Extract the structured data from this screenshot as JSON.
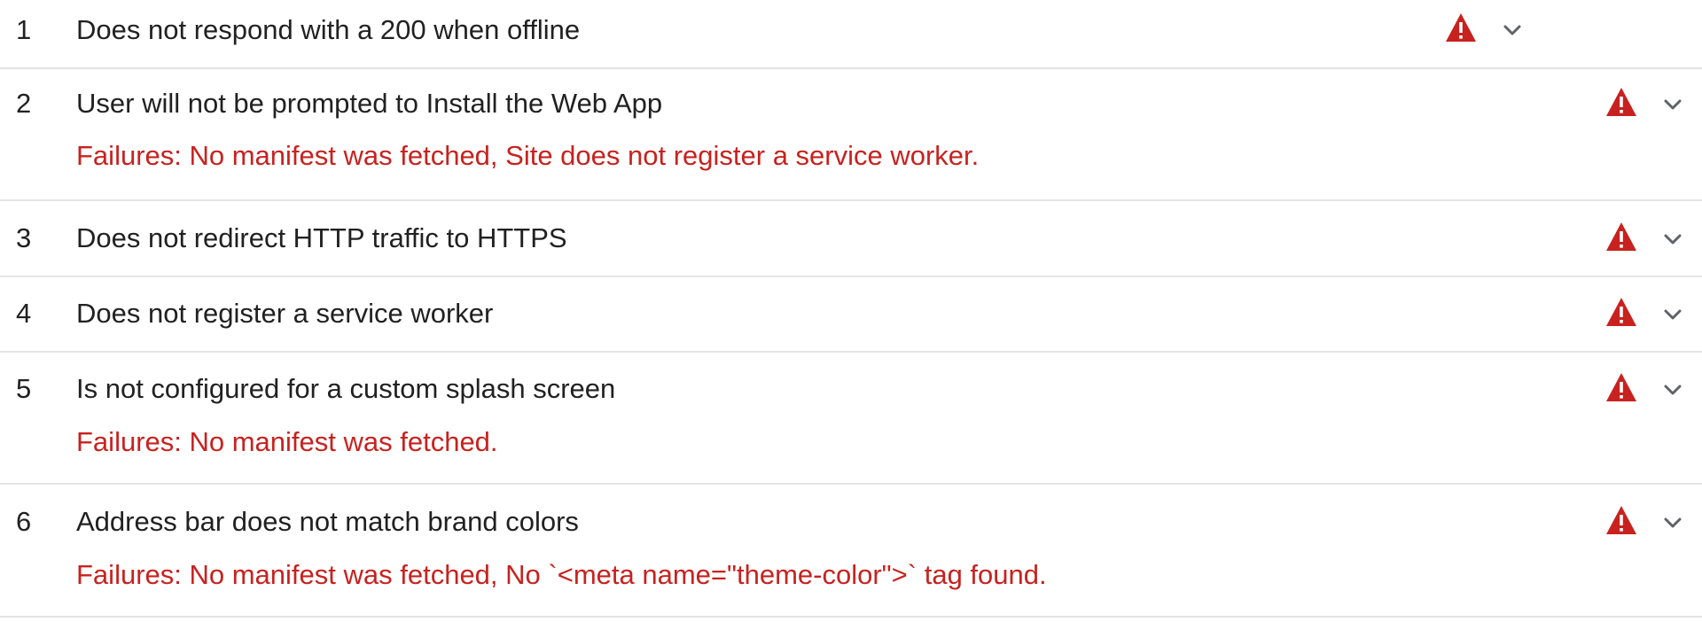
{
  "audits": [
    {
      "number": "1",
      "title": "Does not respond with a 200 when offline",
      "failure": "",
      "status_icon": "warning-triangle-icon",
      "expand_icon": "chevron-down-icon"
    },
    {
      "number": "2",
      "title": "User will not be prompted to Install the Web App",
      "failure": "Failures: No manifest was fetched, Site does not register a service worker.",
      "status_icon": "warning-triangle-icon",
      "expand_icon": "chevron-down-icon"
    },
    {
      "number": "3",
      "title": "Does not redirect HTTP traffic to HTTPS",
      "failure": "",
      "status_icon": "warning-triangle-icon",
      "expand_icon": "chevron-down-icon"
    },
    {
      "number": "4",
      "title": "Does not register a service worker",
      "failure": "",
      "status_icon": "warning-triangle-icon",
      "expand_icon": "chevron-down-icon"
    },
    {
      "number": "5",
      "title": "Is not configured for a custom splash screen",
      "failure": "Failures: No manifest was fetched.",
      "status_icon": "warning-triangle-icon",
      "expand_icon": "chevron-down-icon"
    },
    {
      "number": "6",
      "title": "Address bar does not match brand colors",
      "failure": "Failures: No manifest was fetched, No `<meta name=\"theme-color\">` tag found.",
      "status_icon": "warning-triangle-icon",
      "expand_icon": "chevron-down-icon"
    }
  ],
  "colors": {
    "fail": "#c7221f",
    "text": "#212121",
    "divider": "#e4e4e4",
    "chevron": "#5f6368"
  }
}
